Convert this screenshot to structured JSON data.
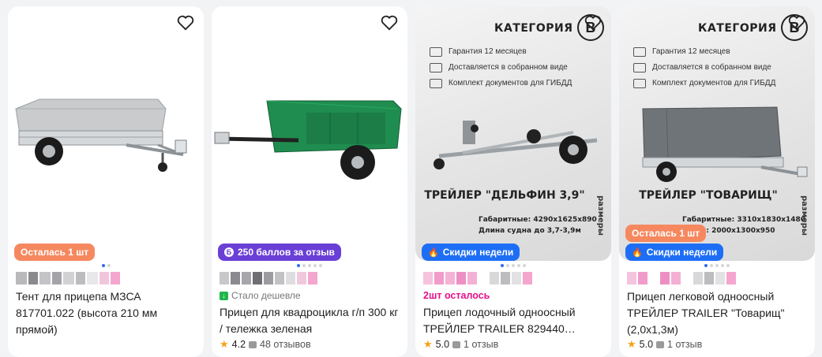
{
  "products": [
    {
      "image_alt": "trailer tent",
      "badge": "Осталась 1 шт",
      "badge_type": "orange",
      "title": "Тент для прицепа МЗСА 817701.022 (высота 210 мм прямой)",
      "meta": "",
      "rating": "",
      "reviews": ""
    },
    {
      "image_alt": "green atv trailer",
      "badge": "250 баллов за отзыв",
      "badge_type": "purple",
      "meta": "Стало дешевле",
      "title": "Прицеп для квадроцикла г/п 300 кг / тележка зеленая",
      "rating": "4.2",
      "reviews": "48 отзывов"
    },
    {
      "image_alt": "boat trailer",
      "category": "КАТЕГОРИЯ",
      "category_letter": "B",
      "features": [
        "Гарантия 12 месяцев",
        "Доставляется в собранном виде",
        "Комплект документов для ГИБДД"
      ],
      "promo_name": "ТРЕЙЛЕР \"ДЕЛЬФИН 3,9\"",
      "spec1": "Габаритные: 4290х1625х890",
      "spec2": "Длина судна до 3,7-3,9м",
      "sizes": "размеры",
      "badge": "Скидки недели",
      "badge_type": "blue",
      "meta": "2шт осталось",
      "title": "Прицеп лодочный одноосный ТРЕЙЛЕР TRAILER 829440…",
      "rating": "5.0",
      "reviews": "1 отзыв"
    },
    {
      "image_alt": "cargo trailer with tent",
      "category": "КАТЕГОРИЯ",
      "category_letter": "B",
      "features": [
        "Гарантия 12 месяцев",
        "Доставляется в собранном виде",
        "Комплект документов для ГИБДД"
      ],
      "promo_name": "ТРЕЙЛЕР \"ТОВАРИЩ\"",
      "spec1": "Габаритные: 3310х1830х1480",
      "spec2": "Кузов: 2000х1300х950",
      "sizes": "размеры",
      "badge_extra": "Осталась 1 шт",
      "badge": "Скидки недели",
      "badge_type": "blue",
      "meta": "",
      "title": "Прицеп легковой одноосный ТРЕЙЛЕР TRAILER \"Товарищ\" (2,0х1,3м)",
      "rating": "5.0",
      "reviews": "1 отзыв"
    }
  ],
  "colors": {
    "badge_orange": "#f6885f",
    "badge_purple": "#6a3fd6",
    "badge_blue": "#1e6ef5",
    "accent_pink": "#e4118b",
    "star": "#f6a21a"
  },
  "icons": [
    "heart-icon",
    "star-icon",
    "review-bubble-icon",
    "fire-icon",
    "coin-icon",
    "arrow-down-icon"
  ]
}
